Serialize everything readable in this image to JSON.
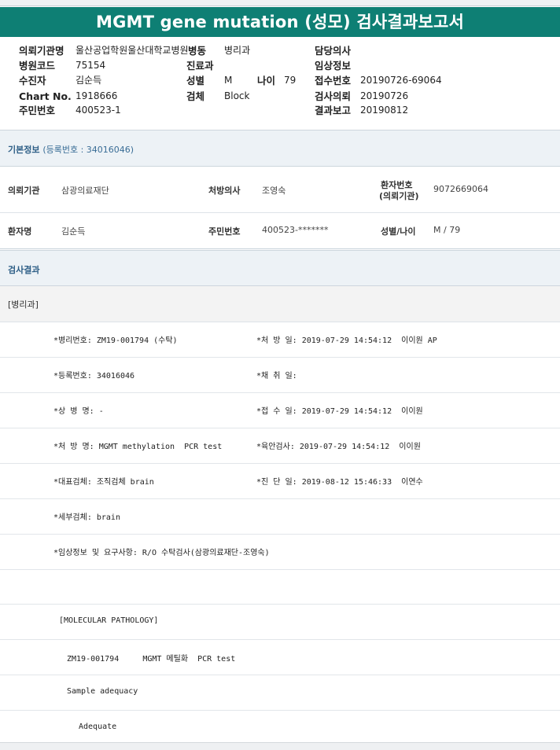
{
  "title": "MGMT gene mutation (성모) 검사결과보고서",
  "header": {
    "institution_label": "의뢰기관명",
    "institution_value": "울산공업학원울산대학교병원",
    "ward_label": "병동",
    "ward_value": "병리과",
    "doctor_label": "담당의사",
    "hospital_code_label": "병원코드",
    "hospital_code_value": "75154",
    "dept_label": "진료과",
    "clinical_info_label": "임상정보",
    "collector_label": "수진자",
    "collector_value": "김순득",
    "sex_label": "성별",
    "sex_value": "M",
    "age_label": "나이",
    "age_value": "79",
    "receipt_no_label": "접수번호",
    "receipt_no_value": "20190726-69064",
    "chart_label": "Chart No.",
    "chart_value": "1918666",
    "specimen_label": "검체",
    "specimen_value": "Block",
    "request_label": "검사의뢰",
    "request_value": "20190726",
    "resident_label": "주민번호",
    "resident_value": "400523-1",
    "report_label": "결과보고",
    "report_value": "20190812"
  },
  "basic_info": {
    "section_title": "기본정보",
    "reg_text": "(등록번호 : 34016046)",
    "org_label": "의뢰기관",
    "org_value": "삼광의료재단",
    "prescriber_label": "처방의사",
    "prescriber_value": "조영숙",
    "patient_no_label_1": "환자번호",
    "patient_no_label_2": "(의뢰기관)",
    "patient_no_value": "9072669064",
    "name_label": "환자명",
    "name_value": "김순득",
    "resident_label": "주민번호",
    "resident_value": "400523-*******",
    "sexage_label": "성별/나이",
    "sexage_value": "M / 79"
  },
  "results": {
    "section_title": "검사결과",
    "dept": "[병리과]",
    "rows": [
      {
        "left": "*병리번호: ZM19-001794 (수탁)",
        "right": "*처 방 일: 2019-07-29 14:54:12  이이원 AP"
      },
      {
        "left": "*등록번호: 34016046",
        "right": "*채 취 일:"
      },
      {
        "left": "*상 병 명: -",
        "right": "*접 수 일: 2019-07-29 14:54:12  이이원"
      },
      {
        "left": "*처 방 명: MGMT methylation  PCR test",
        "right": "*육안검사: 2019-07-29 14:54:12  이이원"
      },
      {
        "left": "*대표검체: 조직검체 brain",
        "right": "*진 단 일: 2019-08-12 15:46:33  이연수"
      },
      {
        "left": "*세부검체: brain",
        "right": ""
      },
      {
        "left": "*임상정보 및 요구사항: R/O 수탁검사(삼광의료재단-조영숙)",
        "right": ""
      }
    ],
    "mol_path": "[MOLECULAR PATHOLOGY]",
    "test_line": "ZM19-001794     MGMT 메틸화  PCR test",
    "sample_label": "Sample adequacy",
    "adequate": "Adequate"
  }
}
